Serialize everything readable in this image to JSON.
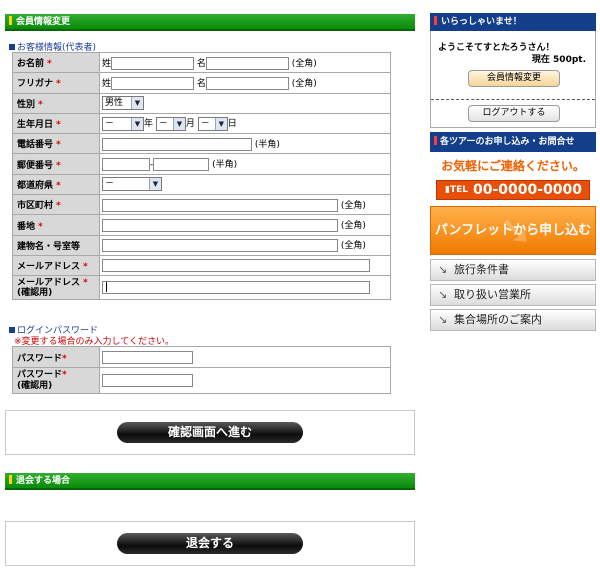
{
  "section_member": {
    "title": "会員情報変更"
  },
  "customer_info": {
    "heading": "お客様情報(代表者)"
  },
  "form": {
    "required_mark": "*",
    "name": {
      "label": "お名前",
      "sei": "姓",
      "mei": "名",
      "note": "(全角)"
    },
    "furigana": {
      "label": "フリガナ",
      "sei": "姓",
      "mei": "名",
      "note": "(全角)"
    },
    "gender": {
      "label": "性別",
      "value": "男性"
    },
    "birthday": {
      "label": "生年月日",
      "year_value": "－",
      "year_unit": "年",
      "month_value": "－",
      "month_unit": "月",
      "day_value": "－",
      "day_unit": "日"
    },
    "phone": {
      "label": "電話番号",
      "note": "(半角)"
    },
    "postal": {
      "label": "郵便番号",
      "sep": "-",
      "note": "(半角)"
    },
    "prefecture": {
      "label": "都道府県",
      "value": "－"
    },
    "city": {
      "label": "市区町村",
      "note": "(全角)"
    },
    "address": {
      "label": "番地",
      "note": "(全角)"
    },
    "building": {
      "label": "建物名・号室等",
      "note": "(全角)"
    },
    "email": {
      "label": "メールアドレス"
    },
    "email_confirm": {
      "label": "メールアドレス",
      "sub": "(確認用)"
    }
  },
  "password_section": {
    "heading": "ログインパスワード",
    "note": "※変更する場合のみ入力してください。",
    "password": {
      "label": "パスワード"
    },
    "password_confirm": {
      "label": "パスワード",
      "sub": "(確認用)"
    }
  },
  "confirm_button": {
    "label": "確認画面へ進む"
  },
  "section_withdraw": {
    "title": "退会する場合"
  },
  "withdraw_button": {
    "label": "退会する"
  },
  "sidebar": {
    "welcome": {
      "title": "いらっしゃいませ！",
      "greeting": "ようこそてすとたろうさん！",
      "points": "現在 500pt.",
      "member_button": "会員情報変更",
      "logout_button": "ログアウトする"
    },
    "tour": {
      "title": "各ツアーのお申し込み・お問合せ",
      "contact_text": "お気軽にご連絡ください。",
      "tel_label": "TEL",
      "tel_number": "00-0000-0000"
    },
    "pamphlet_button": "パンフレットから申し込む",
    "nav": [
      {
        "label": "旅行条件書"
      },
      {
        "label": "取り扱い営業所"
      },
      {
        "label": "集合場所のご案内"
      }
    ]
  },
  "colors": {
    "section_green": "#0a8a0a",
    "sidebar_navy": "#123e8a",
    "required_red": "#e00000",
    "accent_orange": "#f07a00"
  }
}
